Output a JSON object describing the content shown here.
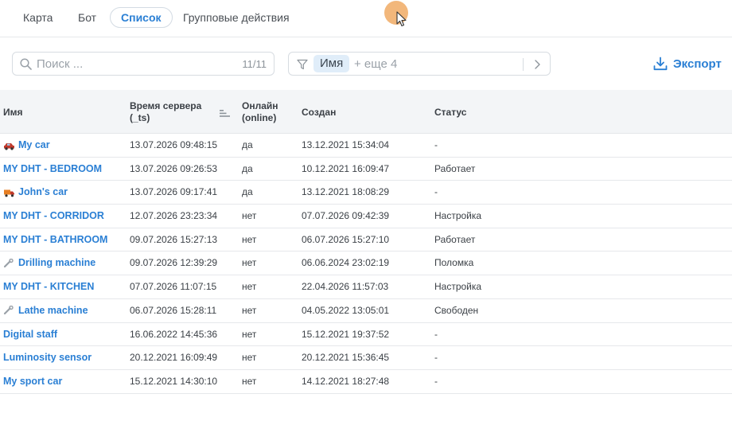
{
  "tabs": [
    {
      "label": "Карта",
      "active": false
    },
    {
      "label": "Бот",
      "active": false
    },
    {
      "label": "Список",
      "active": true
    },
    {
      "label": "Групповые действия",
      "active": false
    }
  ],
  "search": {
    "placeholder": "Поиск ...",
    "count": "11/11"
  },
  "filter": {
    "chip": "Имя",
    "more": "+ еще 4"
  },
  "export": {
    "label": "Экспорт"
  },
  "table": {
    "headers": {
      "name": "Имя",
      "server_time_1": "Время сервера",
      "server_time_2": "(_ts)",
      "online_1": "Онлайн",
      "online_2": "(online)",
      "created": "Создан",
      "status": "Статус"
    },
    "rows": [
      {
        "icon": "car-icon",
        "name": "My car",
        "time": "13.07.2026 09:48:15",
        "online": "да",
        "created": "13.12.2021 15:34:04",
        "status": "-"
      },
      {
        "icon": "",
        "name": "MY DHT - BEDROOM",
        "time": "13.07.2026 09:26:53",
        "online": "да",
        "created": "10.12.2021 16:09:47",
        "status": "Работает"
      },
      {
        "icon": "truck-icon",
        "name": "John's car",
        "time": "13.07.2026 09:17:41",
        "online": "да",
        "created": "13.12.2021 18:08:29",
        "status": "-"
      },
      {
        "icon": "",
        "name": "MY DHT - CORRIDOR",
        "time": "12.07.2026 23:23:34",
        "online": "нет",
        "created": "07.07.2026 09:42:39",
        "status": "Настройка"
      },
      {
        "icon": "",
        "name": "MY DHT - BATHROOM",
        "time": "09.07.2026 15:27:13",
        "online": "нет",
        "created": "06.07.2026 15:27:10",
        "status": "Работает"
      },
      {
        "icon": "wrench-icon",
        "name": "Drilling machine",
        "time": "09.07.2026 12:39:29",
        "online": "нет",
        "created": "06.06.2024 23:02:19",
        "status": "Поломка"
      },
      {
        "icon": "",
        "name": "MY DHT - KITCHEN",
        "time": "07.07.2026 11:07:15",
        "online": "нет",
        "created": "22.04.2026 11:57:03",
        "status": "Настройка"
      },
      {
        "icon": "wrench-icon",
        "name": "Lathe machine",
        "time": "06.07.2026 15:28:11",
        "online": "нет",
        "created": "04.05.2022 13:05:01",
        "status": "Свободен"
      },
      {
        "icon": "",
        "name": "Digital staff",
        "time": "16.06.2022 14:45:36",
        "online": "нет",
        "created": "15.12.2021 19:37:52",
        "status": "-"
      },
      {
        "icon": "",
        "name": "Luminosity sensor",
        "time": "20.12.2021 16:09:49",
        "online": "нет",
        "created": "20.12.2021 15:36:45",
        "status": "-"
      },
      {
        "icon": "",
        "name": "My sport car",
        "time": "15.12.2021 14:30:10",
        "online": "нет",
        "created": "14.12.2021 18:27:48",
        "status": "-"
      }
    ]
  },
  "colors": {
    "accent": "#2a7fd4",
    "chip_bg": "#e0edf9",
    "header_bg": "#f3f5f7",
    "cursor": "#f0aa64"
  }
}
